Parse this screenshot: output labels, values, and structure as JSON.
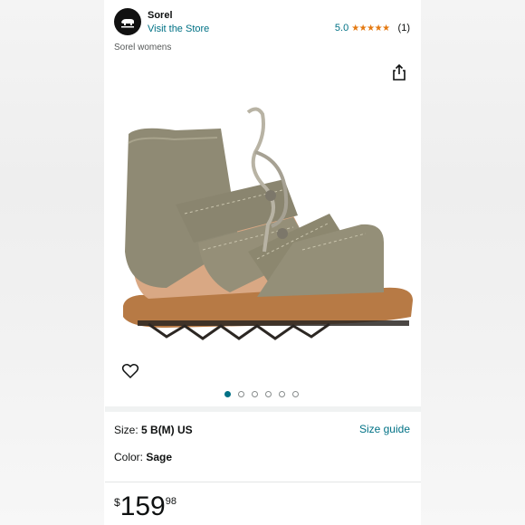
{
  "header": {
    "brand": "Sorel",
    "visit_store": "Visit the Store",
    "rating_value": "5.0",
    "stars": "★★★★★",
    "rating_count": "(1)",
    "subtitle": "Sorel womens"
  },
  "carousel": {
    "image_count": 6,
    "active_index": 0
  },
  "options": {
    "size_label": "Size: ",
    "size_value": "5 B(M) US",
    "size_guide": "Size guide",
    "color_label": "Color: ",
    "color_value": "Sage"
  },
  "price": {
    "symbol": "$",
    "whole": "159",
    "fraction": "98"
  },
  "colors": {
    "link": "#007185",
    "star": "#e47911",
    "product_upper": "#8f8a74",
    "product_sole": "#b77a45"
  }
}
